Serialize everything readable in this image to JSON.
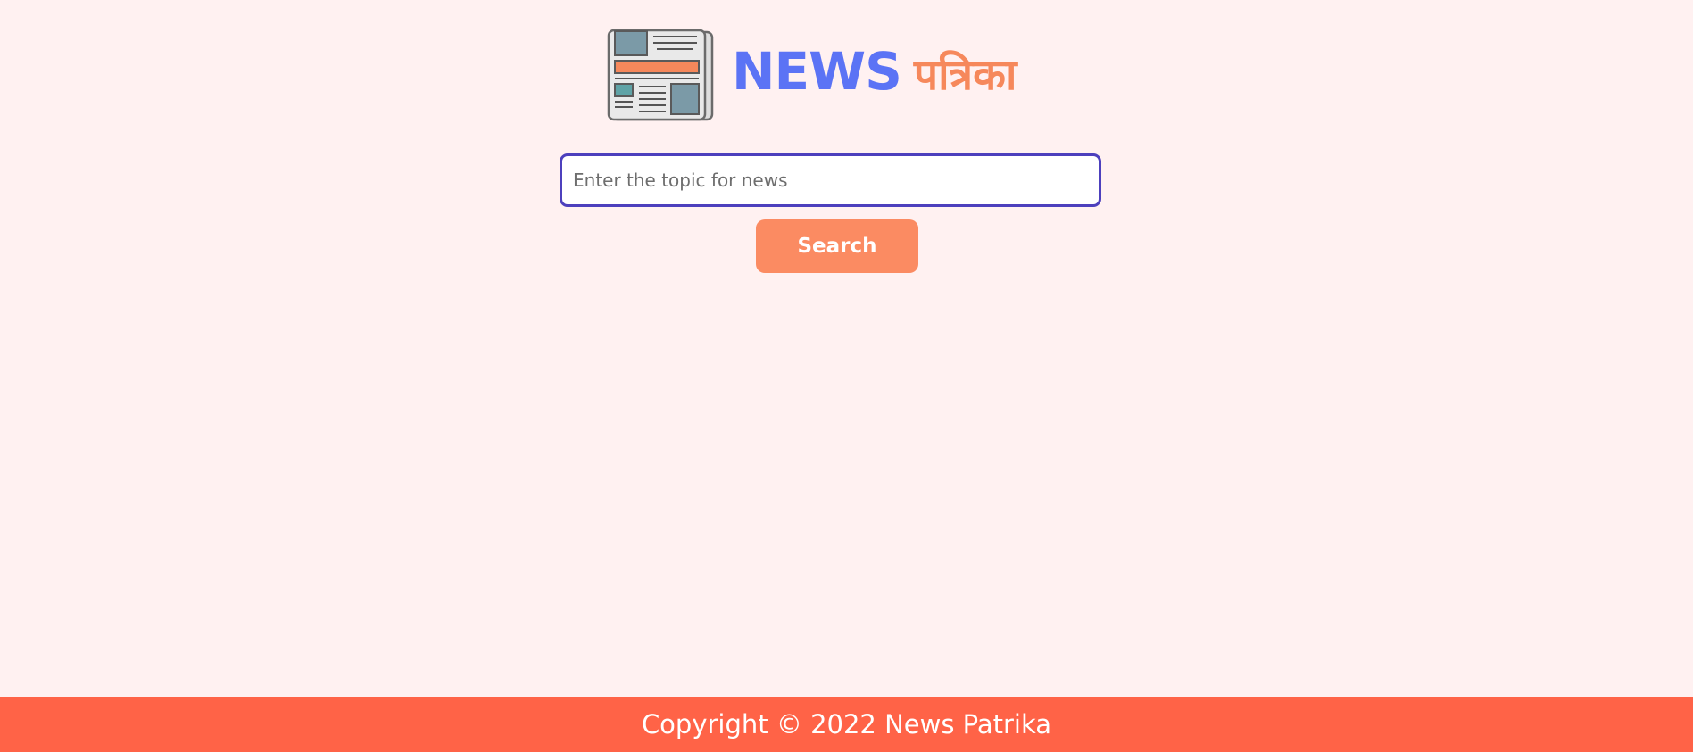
{
  "header": {
    "logo_icon": "newspaper-icon",
    "brand_primary": "NEWS",
    "brand_secondary": "पत्रिका"
  },
  "search": {
    "value": "",
    "placeholder": "Enter the topic for news",
    "button_label": "Search"
  },
  "footer": {
    "copyright": "Copyright © 2022 News Patrika"
  },
  "colors": {
    "background": "#fff1f1",
    "brand_primary": "#5b73f5",
    "brand_secondary": "#f6885b",
    "input_border": "#4d40bd",
    "button": "#fb8b62",
    "footer": "#ff6347"
  }
}
